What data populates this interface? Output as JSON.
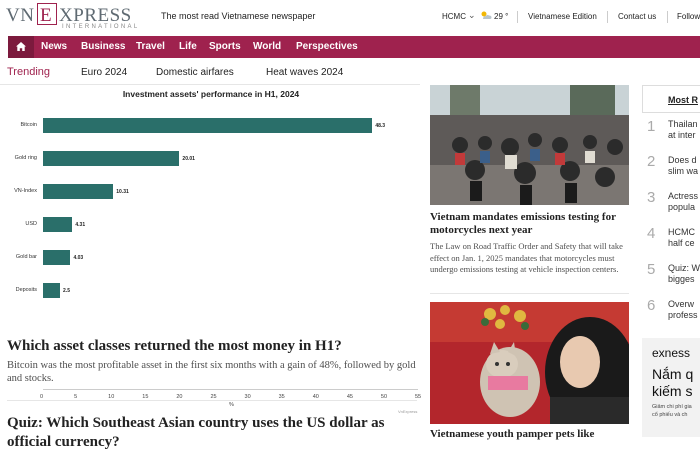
{
  "header": {
    "logo_vn": "VN",
    "logo_e": "E",
    "logo_xpress": "XPRESS",
    "logo_intl": "INTERNATIONAL",
    "tagline": "The most read Vietnamese newspaper",
    "location": "HCMC",
    "weather_icon": "partly-cloudy-icon",
    "temperature": "29 °",
    "edition": "Vietnamese Edition",
    "contact": "Contact us",
    "follow": "Follow"
  },
  "nav": {
    "home_icon": "home-icon",
    "items": [
      "News",
      "Business",
      "Travel",
      "Life",
      "Sports",
      "World",
      "Perspectives"
    ]
  },
  "trending": {
    "label": "Trending",
    "items": [
      "Euro 2024",
      "Domestic airfares",
      "Heat waves 2024"
    ]
  },
  "chart_data": {
    "type": "bar",
    "orientation": "horizontal",
    "title": "Investment assets' performance in H1, 2024",
    "categories": [
      "Bitcoin",
      "Gold ring",
      "VN-Index",
      "USD",
      "Gold bar",
      "Deposits"
    ],
    "values": [
      48.3,
      20.01,
      10.31,
      4.31,
      4.03,
      2.5
    ],
    "value_labels": [
      "48.3",
      "20.01",
      "10.31",
      "4.31",
      "4.03",
      "2.5"
    ],
    "xlabel": "%",
    "xlim": [
      0,
      55
    ],
    "xticks": [
      0,
      5,
      10,
      15,
      20,
      25,
      30,
      35,
      40,
      45,
      50,
      55
    ],
    "bar_color": "#2a6f6a",
    "source": "VnExpress"
  },
  "main": {
    "headline": "Which asset classes returned the most money in H1?",
    "lead": "Bitcoin was the most profitable asset in the first six months with a gain of 48%, followed by gold and stocks.",
    "next_headline": "Quiz: Which Southeast Asian country uses the US dollar as official currency?"
  },
  "stories": [
    {
      "title": "Vietnam mandates emissions testing for motorcycles next year",
      "lead": "The Law on Road Traffic Order and Safety that will take effect on Jan. 1, 2025 mandates that motorcycles must undergo emissions testing at vehicle inspection centers."
    },
    {
      "title": "Vietnamese youth pamper pets like"
    }
  ],
  "most_read": {
    "title": "Most R",
    "items": [
      {
        "num": "1",
        "line1": "Thailan",
        "line2": "at inter"
      },
      {
        "num": "2",
        "line1": "Does d",
        "line2": "slim wa"
      },
      {
        "num": "3",
        "line1": "Actress",
        "line2": "popula"
      },
      {
        "num": "4",
        "line1": "HCMC",
        "line2": "half ce"
      },
      {
        "num": "5",
        "line1": "Quiz: W",
        "line2": "bigges"
      },
      {
        "num": "6",
        "line1": "Overw",
        "line2": "profess"
      }
    ]
  },
  "ad": {
    "logo": "exness",
    "line1": "Nắm q",
    "line2": "kiếm s",
    "small1": "Giảm chi phí gia",
    "small2": "cổ phiếu và ch"
  },
  "colors": {
    "brand": "#9f224e",
    "brand_dark": "#7c1a3d",
    "chart_bar": "#2a6f6a"
  }
}
